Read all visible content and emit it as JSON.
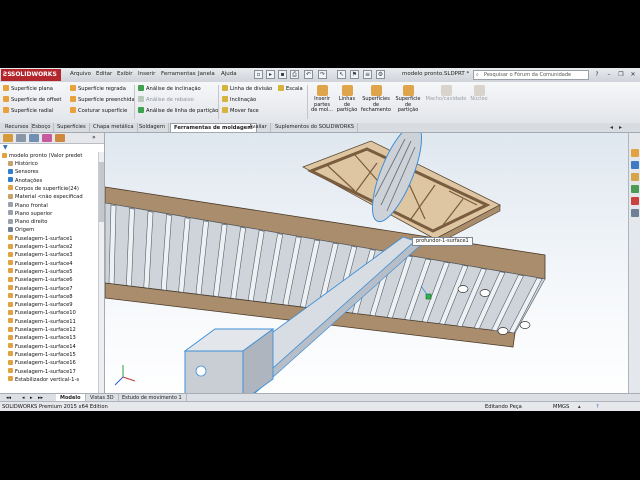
{
  "app": {
    "logo_text": "SOLIDWORKS",
    "document_title": "modelo pronto.SLDPRT *",
    "search_placeholder": "Pesquisar o Fórum da Comunidade"
  },
  "menu": [
    "Arquivo",
    "Editar",
    "Exibir",
    "Inserir",
    "Ferramentas",
    "Janela",
    "Ajuda"
  ],
  "ribbon": {
    "col1": [
      "Superfície plana",
      "Superfície de offset",
      "Superfície radial"
    ],
    "col2": [
      "Superfície regrada",
      "Superfície preenchida",
      "Costurar superfície"
    ],
    "col3": [
      "Análise de inclinação",
      "Análise de rebaixo",
      "Análise de linha de partição"
    ],
    "col4": [
      "Linha de divisão",
      "Inclinação",
      "Mover face"
    ],
    "escala": "Escala",
    "big": [
      {
        "label": "Inserir\npartes\nde mol...",
        "disabled": false
      },
      {
        "label": "Linhas\nde\npartição",
        "disabled": false
      },
      {
        "label": "Superfícies\nde\nfechamento",
        "disabled": false
      },
      {
        "label": "Superfície\nde\npartição",
        "disabled": false
      },
      {
        "label": "Macho/cavidade",
        "disabled": true
      },
      {
        "label": "Núcleo",
        "disabled": true
      }
    ]
  },
  "tabs": [
    "Recursos",
    "Esboço",
    "Superfícies",
    "Chapa metálica",
    "Soldagem",
    "Ferramentas de moldagem",
    "Avaliar",
    "Suplementos do SOLIDWORKS"
  ],
  "active_tab": "Ferramentas de moldagem",
  "tree": {
    "root": "modelo pronto  (Valor predet",
    "items": [
      "Histórico",
      "Sensores",
      "Anotações",
      "Corpos de superfície(24)",
      "Material <não especificad",
      "Plano frontal",
      "Plano superior",
      "Plano direito",
      "Origem",
      "Fuselagem-1-surface1",
      "Fuselagem-1-surface2",
      "Fuselagem-1-surface3",
      "Fuselagem-1-surface4",
      "Fuselagem-1-surface5",
      "Fuselagem-1-surface6",
      "Fuselagem-1-surface7",
      "Fuselagem-1-surface8",
      "Fuselagem-1-surface9",
      "Fuselagem-1-surface10",
      "Fuselagem-1-surface11",
      "Fuselagem-1-surface12",
      "Fuselagem-1-surface13",
      "Fuselagem-1-surface14",
      "Fuselagem-1-surface15",
      "Fuselagem-1-surface16",
      "Fuselagem-1-surface17",
      "Estabilizador vertical-1-s"
    ]
  },
  "viewport": {
    "callout": "profundor-1-surface1"
  },
  "bottom_tabs": [
    "Modelo",
    "Vistas 3D",
    "Estudo de movimento 1"
  ],
  "status": {
    "edition": "SOLIDWORKS Premium 2015 x64 Edition",
    "mode": "Editando Peça",
    "units": "MMGS"
  },
  "colors": {
    "wood": "#b59a78",
    "edge_highlight": "#3f8fd6",
    "accent_red": "#b3262b"
  }
}
